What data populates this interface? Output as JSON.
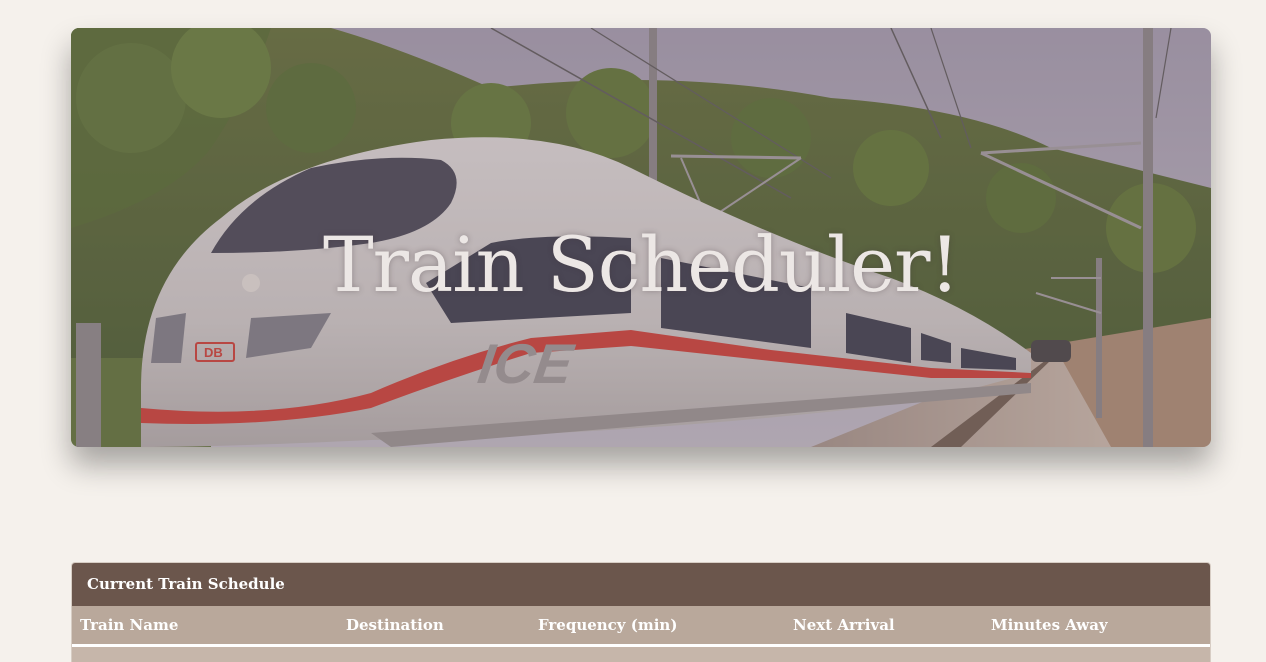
{
  "hero": {
    "title": "Train Scheduler!",
    "train_badge": "DB",
    "train_model": "ICE"
  },
  "schedule": {
    "heading": "Current Train Schedule",
    "columns": [
      "Train Name",
      "Destination",
      "Frequency (min)",
      "Next Arrival",
      "Minutes Away"
    ],
    "rows": []
  },
  "colors": {
    "page_background": "#f5f1ec",
    "panel_heading": "#6b564c",
    "table_header": "#b9a89b",
    "hero_overlay": "#7d6a73",
    "train_stripe": "#d8352a"
  }
}
